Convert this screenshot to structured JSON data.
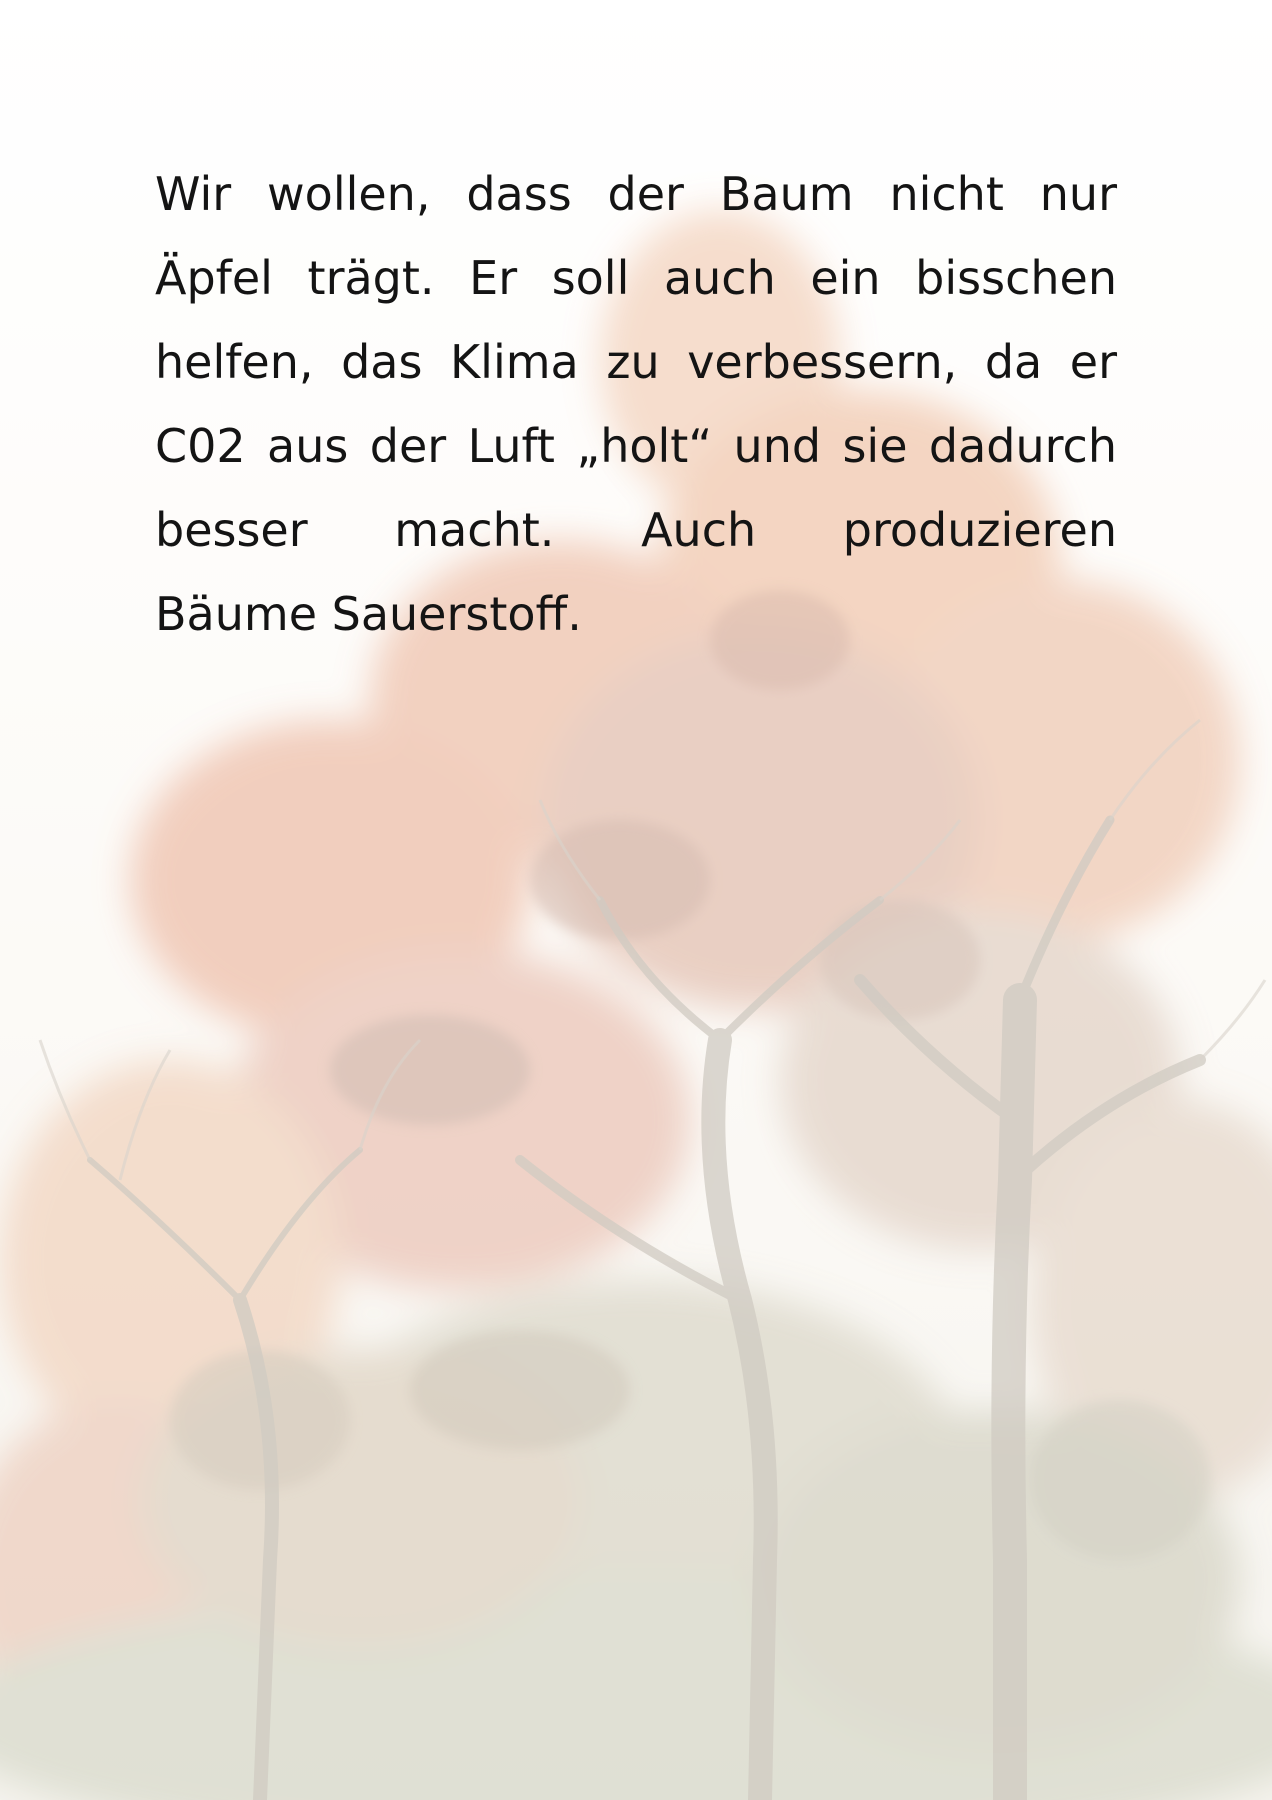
{
  "document": {
    "paragraph_lines": [
      "Wir wollen, dass der Baum nicht nur",
      "Äpfel trägt. Er soll auch ein bisschen",
      "helfen, das Klima zu verbessern, da er",
      "C02 aus der Luft „holt“ und sie dadurch",
      "besser macht. Auch produzieren",
      "Bäume Sauerstoff."
    ]
  },
  "colors": {
    "text": "#141414",
    "foliage_orange": "#e8a27a",
    "foliage_red": "#dc8f7e",
    "foliage_green": "#b9bea7",
    "trunk": "#b3ac9f"
  },
  "background": {
    "description_icon": "autumn-tree-photo"
  }
}
